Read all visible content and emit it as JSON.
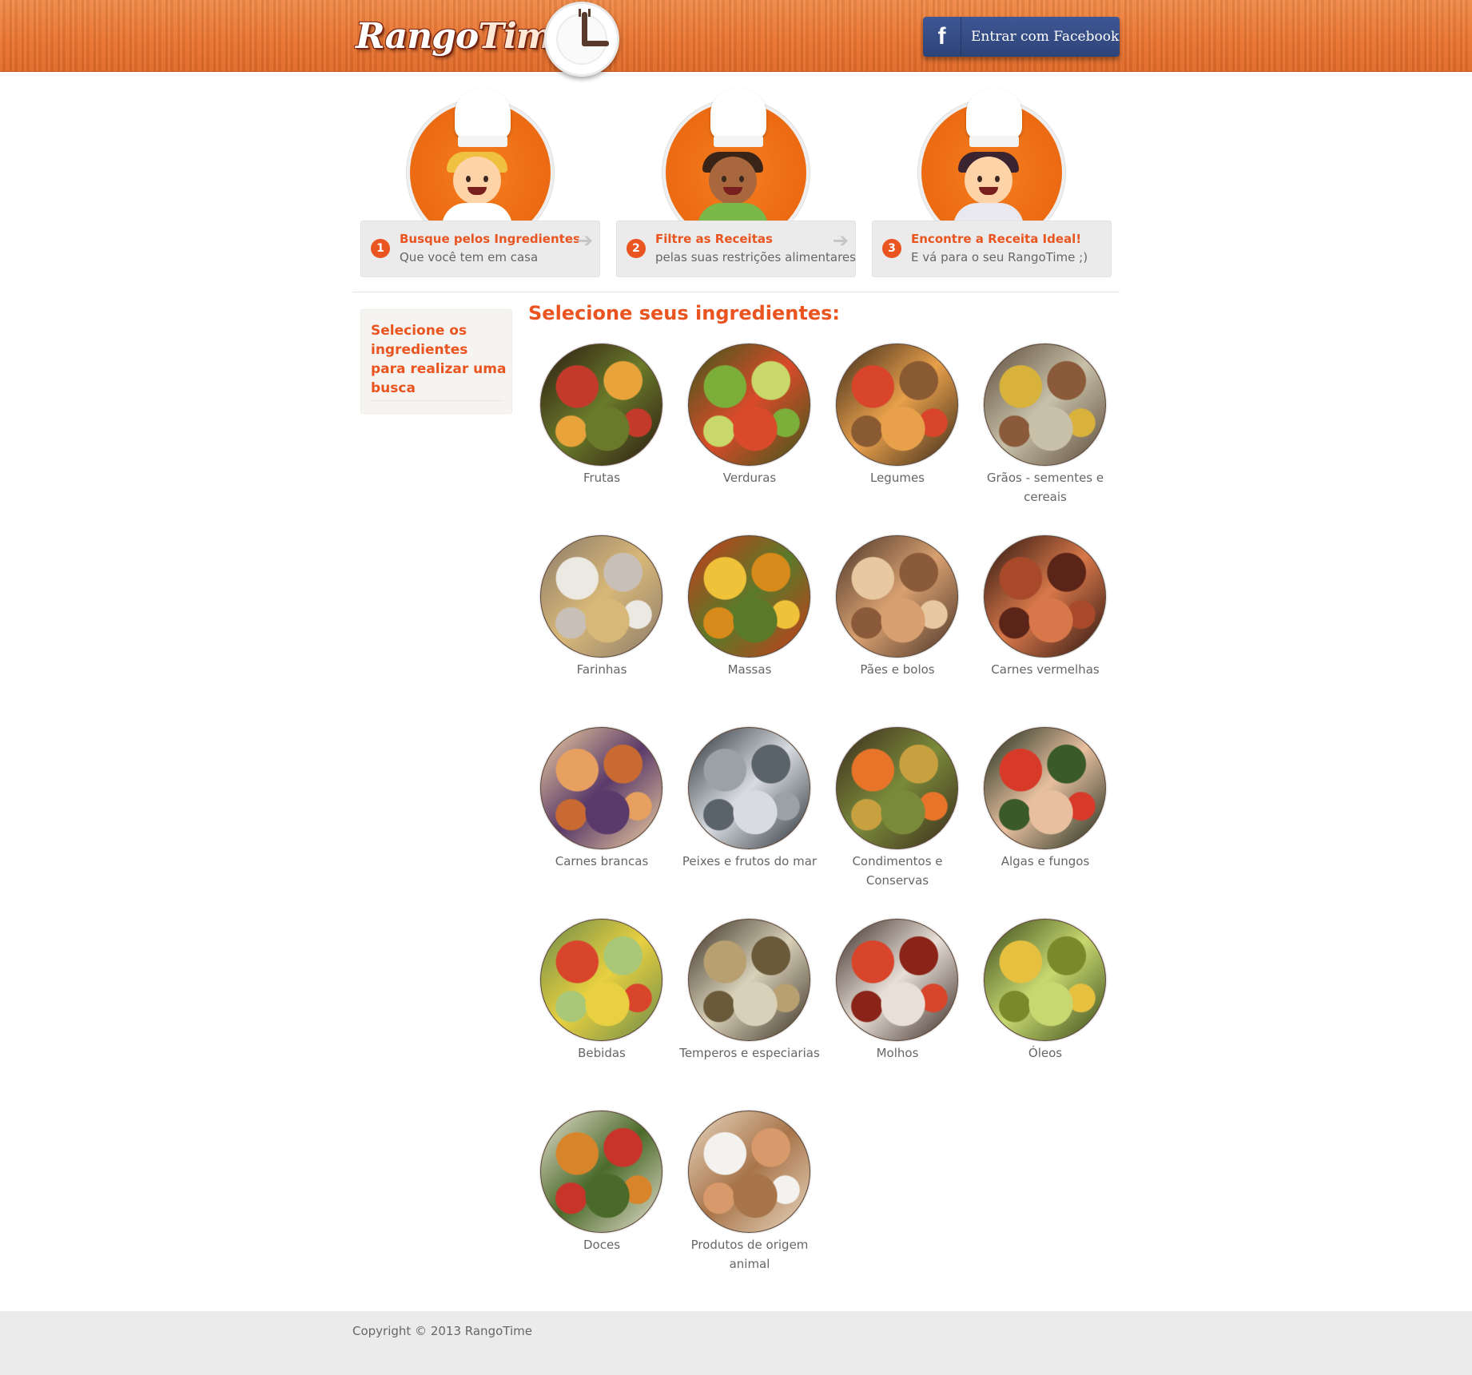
{
  "header": {
    "logo": {
      "brand_part1": "Rango",
      "brand_part2": "Time"
    },
    "facebook_button": {
      "icon": "facebook-icon",
      "label": "Entrar com Facebook"
    }
  },
  "steps": [
    {
      "number": "1",
      "title": "Busque pelos Ingredientes",
      "subtitle": "Que você tem em casa",
      "has_arrow": true
    },
    {
      "number": "2",
      "title": "Filtre as Receitas",
      "subtitle": "pelas suas restrições alimentares",
      "has_arrow": true
    },
    {
      "number": "3",
      "title": "Encontre a Receita Ideal!",
      "subtitle": "E vá para o seu RangoTime ;)",
      "has_arrow": false
    }
  ],
  "sidebar": {
    "text": "Selecione os ingredientes para realizar uma busca"
  },
  "main": {
    "title": "Selecione seus ingredientes:",
    "categories": [
      {
        "label": "Frutas",
        "palette": [
          "#c43a2a",
          "#e8a33a",
          "#6a7a2a",
          "#2a1a12"
        ]
      },
      {
        "label": "Verduras",
        "palette": [
          "#7cae3a",
          "#c8d86a",
          "#d94a2a",
          "#3a5a1a"
        ]
      },
      {
        "label": "Legumes",
        "palette": [
          "#d8452a",
          "#8a5a32",
          "#e8a04a",
          "#3a2a1c"
        ]
      },
      {
        "label": "Grãos - sementes e cereais",
        "palette": [
          "#d8b23a",
          "#8a5a3a",
          "#c8c0a8",
          "#5a4a3a"
        ]
      },
      {
        "label": "Farinhas",
        "palette": [
          "#ece8e2",
          "#c8c0b8",
          "#d8b878",
          "#8a7a6a"
        ]
      },
      {
        "label": "Massas",
        "palette": [
          "#f0c23a",
          "#d88a1a",
          "#5a7a2a",
          "#c83a1a"
        ]
      },
      {
        "label": "Pães e bolos",
        "palette": [
          "#e8c8a0",
          "#8a5a3a",
          "#d8a070",
          "#4a3428"
        ]
      },
      {
        "label": "Carnes vermelhas",
        "palette": [
          "#a84a2a",
          "#5a2418",
          "#d8784a",
          "#2a1410"
        ]
      },
      {
        "label": "Carnes brancas",
        "palette": [
          "#e8a060",
          "#c86a32",
          "#5a3a6a",
          "#f0d0a0"
        ]
      },
      {
        "label": "Peixes e frutos do mar",
        "palette": [
          "#9aa2a8",
          "#5a626a",
          "#d8dce0",
          "#2a3238"
        ]
      },
      {
        "label": "Condimentos e Conservas",
        "palette": [
          "#e8742a",
          "#c8a040",
          "#7a8a3a",
          "#3a2a1c"
        ]
      },
      {
        "label": "Algas e fungos",
        "palette": [
          "#d83a2a",
          "#3a5a2a",
          "#e8c0a0",
          "#1a2a1a"
        ]
      },
      {
        "label": "Bebidas",
        "palette": [
          "#d8452a",
          "#a8c878",
          "#e8d040",
          "#6a8a4a"
        ]
      },
      {
        "label": "Temperos e especiarias",
        "palette": [
          "#b8a070",
          "#6a5a3a",
          "#d8d0b8",
          "#3a3024"
        ]
      },
      {
        "label": "Molhos",
        "palette": [
          "#d8452a",
          "#8a2418",
          "#e8e0d8",
          "#3a2a24"
        ]
      },
      {
        "label": "Óleos",
        "palette": [
          "#e8c040",
          "#7a8a2a",
          "#c8d870",
          "#3a4a1a"
        ]
      },
      {
        "label": "Doces",
        "palette": [
          "#d8842a",
          "#c8342a",
          "#4a6a2a",
          "#e8e0d0"
        ]
      },
      {
        "label": "Produtos de origem animal",
        "palette": [
          "#f4f2ee",
          "#d89a6a",
          "#a8744a",
          "#e8d8c0"
        ]
      }
    ]
  },
  "footer": {
    "copyright": "Copyright © 2013 RangoTime"
  },
  "colors": {
    "accent": "#e95420",
    "header_orange": "#ea7633",
    "facebook_blue": "#344f8c"
  }
}
